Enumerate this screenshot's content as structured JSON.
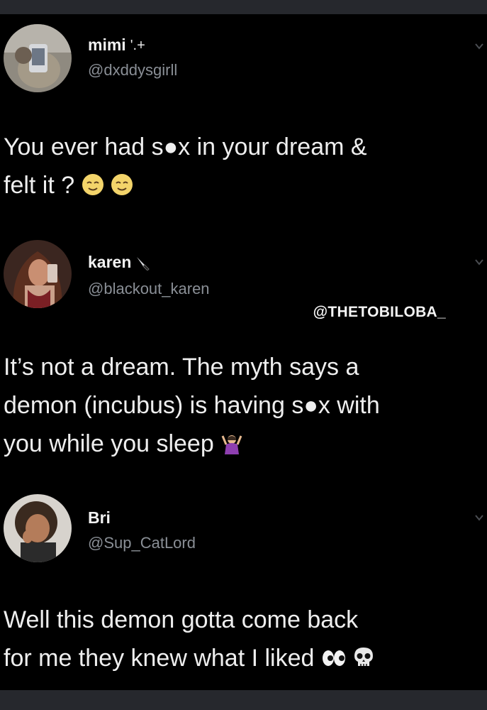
{
  "tweets": [
    {
      "display_name": "mimi",
      "name_emoji": "'.+",
      "handle": "@dxddysgirll",
      "text_lines": [
        "You ever had s●x in your dream &",
        "felt it ?"
      ],
      "emoji_after": [
        "relieved-face",
        "relieved-face"
      ]
    },
    {
      "display_name": "karen",
      "name_emoji": "knife",
      "handle": "@blackout_karen",
      "text_lines": [
        "It’s not a dream. The myth says a",
        "demon (incubus) is having s●x with",
        "you while you sleep"
      ],
      "emoji_after": [
        "person-gesturing-ok"
      ]
    },
    {
      "display_name": "Bri",
      "name_emoji": "",
      "handle": "@Sup_CatLord",
      "text_lines": [
        "Well this demon gotta come back",
        "for me they knew what I liked"
      ],
      "emoji_after": [
        "eyes",
        "skull"
      ]
    }
  ],
  "watermark": "@THETOBILOBA_",
  "colors": {
    "background": "#000000",
    "frame": "#26282d",
    "text": "#eeeeee",
    "handle": "#8a8f96"
  }
}
